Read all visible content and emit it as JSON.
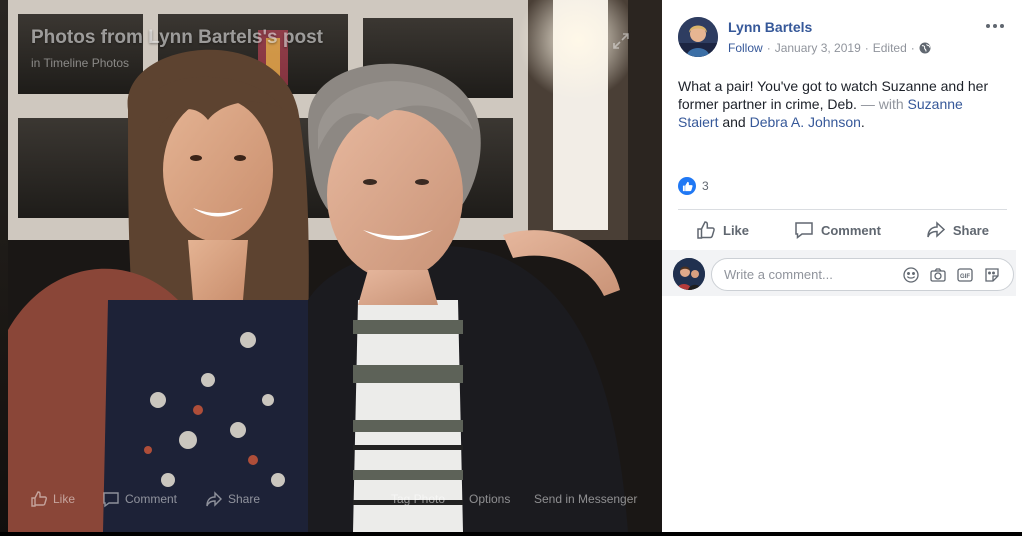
{
  "photo_viewer": {
    "overlay_title": "Photos from Lynn Bartels's post",
    "overlay_subtitle": "in Timeline Photos",
    "bottom_bar": {
      "like": "Like",
      "comment": "Comment",
      "share": "Share",
      "tag_photo": "Tag Photo",
      "options": "Options",
      "send_messenger": "Send in Messenger"
    }
  },
  "post": {
    "author": "Lynn Bartels",
    "follow": "Follow",
    "separator": "·",
    "date": "January 3, 2019",
    "edited": "Edited",
    "text": "What a pair! You've got to watch Suzanne and her former partner in crime, Deb.",
    "with_label": "— with",
    "tag1": "Suzanne Staiert",
    "and_label": "and",
    "tag2": "Debra A. Johnson",
    "period": ".",
    "reaction_count": "3"
  },
  "actions": {
    "like": "Like",
    "comment": "Comment",
    "share": "Share"
  },
  "comment_box": {
    "placeholder": "Write a comment..."
  },
  "colors": {
    "link": "#365899",
    "meta": "#90949c",
    "like_blue": "#2078f4"
  }
}
